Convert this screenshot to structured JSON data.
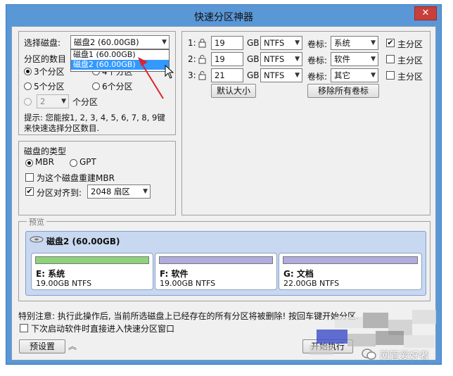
{
  "window": {
    "title": "快速分区神器",
    "close_label": "✕"
  },
  "disk_select": {
    "label": "选择磁盘:",
    "selected": "磁盘2 (60.00GB)",
    "options": [
      "磁盘1 (60.00GB)",
      "磁盘2 (60.00GB)"
    ]
  },
  "partition_count": {
    "label": "分区的数目",
    "options": [
      "3个分区",
      "4个分区",
      "5个分区",
      "6个分区"
    ],
    "custom_value": "2",
    "custom_suffix": "个分区",
    "hint": "提示: 您能按1, 2, 3, 4, 5, 6, 7, 8, 9键来快速选择分区数目."
  },
  "disk_type": {
    "label": "磁盘的类型",
    "mbr": "MBR",
    "gpt": "GPT",
    "rebuild_mbr": "为这个磁盘重建MBR",
    "align_label": "分区对齐到:",
    "align_value": "2048 扇区"
  },
  "partitions": {
    "unit": "GB",
    "volume_label": "卷标:",
    "primary_label": "主分区",
    "rows": [
      {
        "num": "1:",
        "size": "19",
        "fs": "NTFS",
        "volume": "系统",
        "primary": true
      },
      {
        "num": "2:",
        "size": "19",
        "fs": "NTFS",
        "volume": "软件",
        "primary": false
      },
      {
        "num": "3:",
        "size": "21",
        "fs": "NTFS",
        "volume": "其它",
        "primary": false
      }
    ],
    "default_size_btn": "默认大小",
    "remove_labels_btn": "移除所有卷标"
  },
  "preview": {
    "label": "预览",
    "disk_name": "磁盘2 (60.00GB)",
    "parts": [
      {
        "name": "E: 系统",
        "size": "19.00GB NTFS",
        "color": "#8fd27c"
      },
      {
        "name": "F: 软件",
        "size": "19.00GB NTFS",
        "color": "#b0ace0"
      },
      {
        "name": "G: 文档",
        "size": "22.00GB NTFS",
        "color": "#b0ace0"
      }
    ]
  },
  "footer": {
    "warning": "特别注意: 执行此操作后, 当前所选磁盘上已经存在的所有分区将被删除! 按回车键开始分区.",
    "quick_start": "下次启动软件时直接进入快速分区窗口",
    "preset_btn": "预设置",
    "start_btn": "开始执行"
  },
  "watermark": {
    "text": "网管爱好者"
  },
  "colors": {
    "title_bar": "#5a97d6",
    "preview_bg": "#c8d8f0",
    "selection": "#3399ff"
  }
}
